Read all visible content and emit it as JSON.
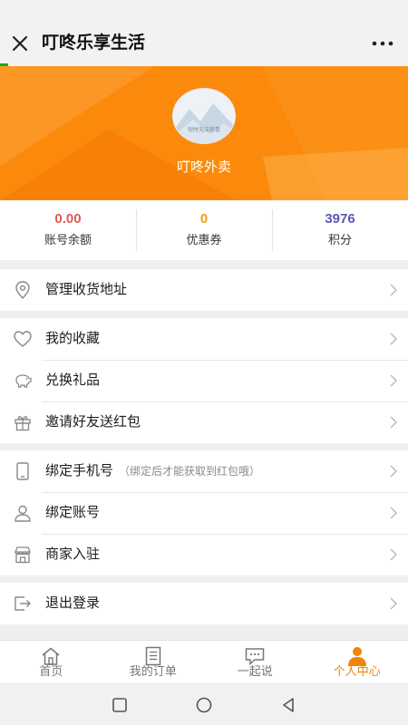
{
  "topbar": {
    "title": "叮咚乐享生活",
    "close_icon": "close-icon",
    "more_icon": "more-icon",
    "page_load_progress": 0.02
  },
  "profile": {
    "avatar_caption": "短时无法查看",
    "username": "叮咚外卖",
    "banner_color": "#fb8a0c"
  },
  "stats": [
    {
      "value": "0.00",
      "label": "账号余额",
      "color": "#e05a4f"
    },
    {
      "value": "0",
      "label": "优惠券",
      "color": "#f29c11"
    },
    {
      "value": "3976",
      "label": "积分",
      "color": "#5b57b8"
    }
  ],
  "menu": {
    "address": {
      "label": "管理收货地址",
      "icon": "location-pin-icon"
    },
    "favorites": {
      "label": "我的收藏",
      "icon": "heart-icon"
    },
    "gifts": {
      "label": "兑换礼品",
      "icon": "piggy-bank-icon"
    },
    "invite": {
      "label": "邀请好友送红包",
      "icon": "gift-box-icon"
    },
    "bind_phone": {
      "label": "绑定手机号",
      "hint": "（绑定后才能获取到红包哦）",
      "icon": "phone-icon"
    },
    "bind_account": {
      "label": "绑定账号",
      "icon": "user-icon"
    },
    "merchant": {
      "label": "商家入驻",
      "icon": "store-icon"
    },
    "logout": {
      "label": "退出登录",
      "icon": "logout-icon"
    }
  },
  "tabs": [
    {
      "label": "首页",
      "icon": "home-icon",
      "active": false
    },
    {
      "label": "我的订单",
      "icon": "orders-icon",
      "active": false
    },
    {
      "label": "一起说",
      "icon": "chat-icon",
      "active": false
    },
    {
      "label": "个人中心",
      "icon": "person-icon",
      "active": true
    }
  ],
  "colors": {
    "accent": "#f0830a",
    "progress": "#1aad19"
  }
}
